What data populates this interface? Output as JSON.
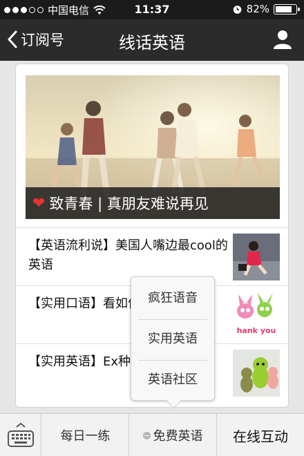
{
  "status_bar": {
    "carrier": "中国电信",
    "time": "11:37",
    "battery_percent": "82%",
    "battery_level": 0.82,
    "signal_bars": 3,
    "icons": [
      "signal-dots-icon",
      "wifi-icon",
      "alarm-clock-icon",
      "battery-icon"
    ]
  },
  "nav": {
    "back_label": "订阅号",
    "title": "线话英语",
    "icons": [
      "chevron-left-icon",
      "person-icon"
    ]
  },
  "hero": {
    "caption": "致青春 | 真朋友难说再见",
    "icon": "heart-icon"
  },
  "articles": [
    {
      "title": "【英语流利说】美国人嘴边最cool的英语"
    },
    {
      "title": "【实用口语】看如何道谢的~绝对"
    },
    {
      "title": "【实用英语】Ex种用法总结"
    }
  ],
  "popup": {
    "items": [
      "疯狂语音",
      "实用英语",
      "英语社区"
    ]
  },
  "bottom_menu": {
    "items": [
      "每日一练",
      "免费英语",
      "在线互动"
    ],
    "icons": [
      "keyboard-icon",
      "submenu-dot-icon"
    ]
  },
  "colors": {
    "status_bar_bg": "#1b1b1b",
    "nav_bg": "#2b2b2b",
    "page_bg": "#e6e6e6",
    "heart": "#e7332e"
  }
}
